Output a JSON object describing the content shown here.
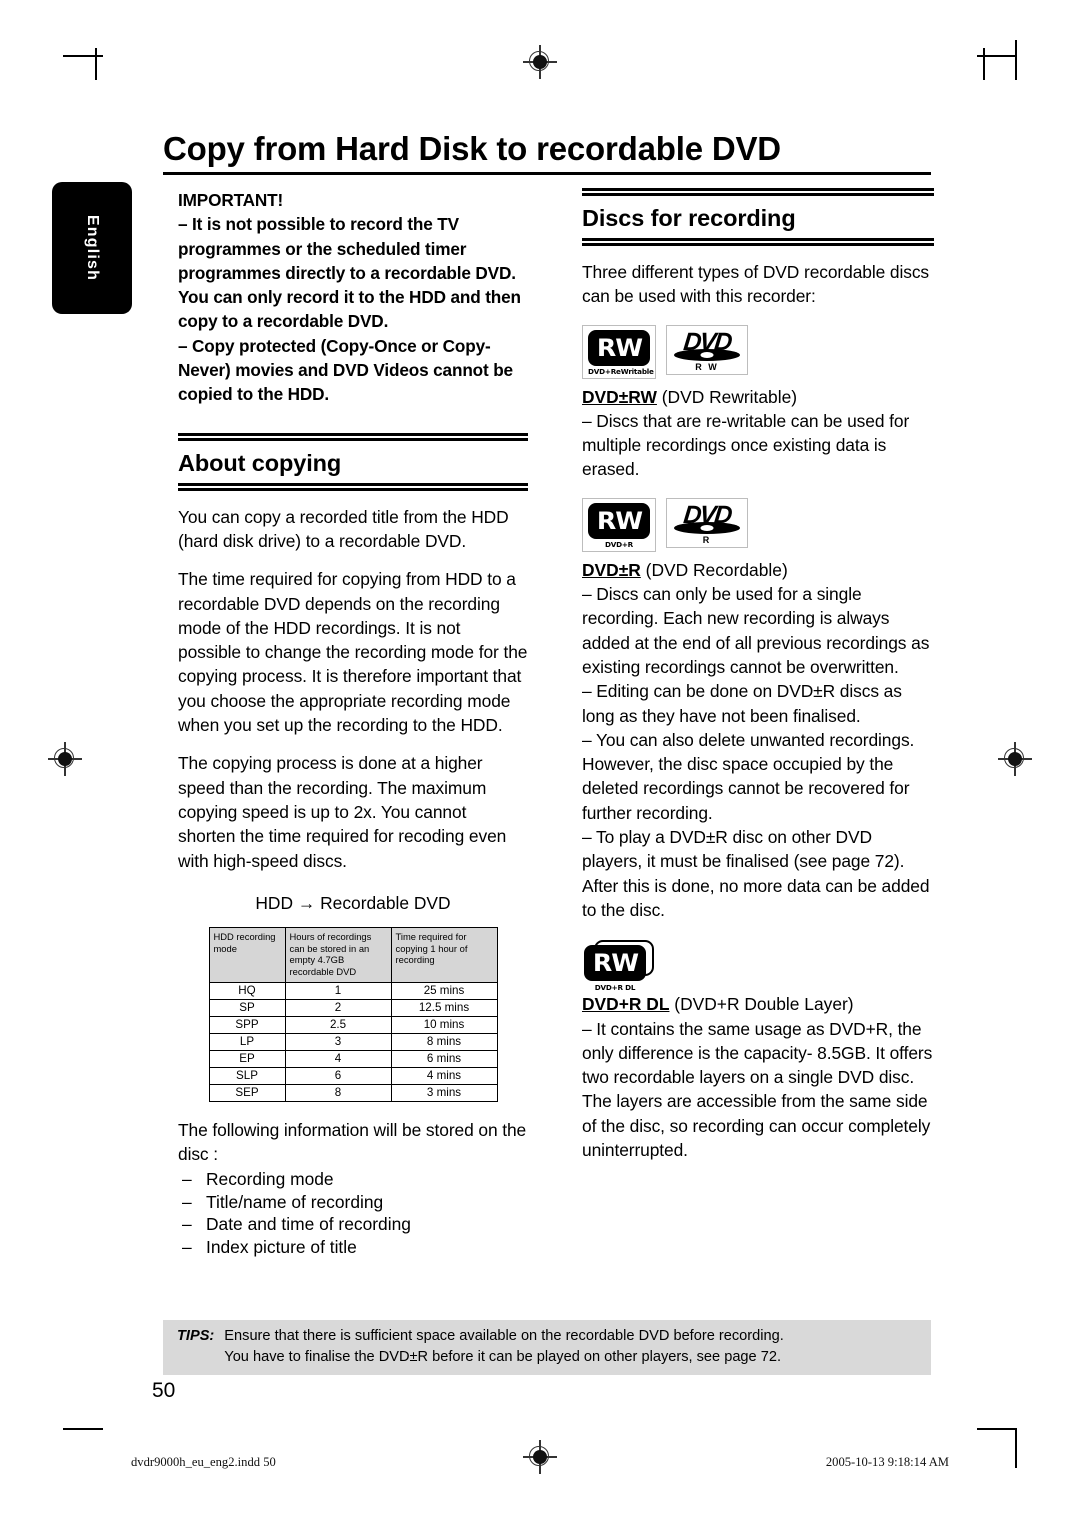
{
  "page": {
    "title": "Copy from Hard Disk to recordable DVD",
    "language_tab": "English",
    "page_number": "50"
  },
  "left_column": {
    "important": {
      "heading": "IMPORTANT!",
      "paragraphs": [
        "– It is not possible to record the TV programmes or the scheduled timer programmes directly to a recordable DVD.  You can only record it to the HDD and then copy to a recordable DVD.",
        "– Copy protected (Copy-Once or Copy-Never) movies and DVD Videos cannot be copied to the HDD."
      ]
    },
    "about_copying": {
      "heading": "About copying",
      "paragraphs": [
        "You can copy a recorded title from the HDD (hard disk drive) to a recordable DVD.",
        "The time required for copying from HDD to a recordable DVD depends on the recording mode of the HDD recordings. It is not possible to change the recording mode for the copying process. It is therefore important that you choose the appropriate recording mode when you set up the recording to the HDD.",
        "The copying process is done at a higher speed than the recording. The maximum copying speed is up to 2x.  You cannot shorten the time required for recoding even with high-speed discs."
      ],
      "flow_caption": "HDD → Recordable DVD"
    },
    "table": {
      "headers": [
        "HDD recording mode",
        "Hours of recordings can be stored in an empty 4.7GB recordable DVD",
        "Time required for copying 1 hour of recording"
      ],
      "rows": [
        [
          "HQ",
          "1",
          "25 mins"
        ],
        [
          "SP",
          "2",
          "12.5 mins"
        ],
        [
          "SPP",
          "2.5",
          "10 mins"
        ],
        [
          "LP",
          "3",
          "8 mins"
        ],
        [
          "EP",
          "4",
          "6 mins"
        ],
        [
          "SLP",
          "6",
          "4 mins"
        ],
        [
          "SEP",
          "8",
          "3 mins"
        ]
      ]
    },
    "stored_info": {
      "intro": "The following information will be stored on the disc :",
      "items": [
        "Recording mode",
        "Title/name of recording",
        "Date and time of recording",
        "Index picture of title"
      ],
      "dash": "–"
    }
  },
  "right_column": {
    "discs_for_recording": {
      "heading": "Discs for recording",
      "intro": "Three different types of DVD recordable discs can be used with this recorder:"
    },
    "dvd_rw": {
      "logo_rw_glyph": "RW",
      "logo_rw_caption": "DVD+ReWritable",
      "logo_dvd_word": "DVD",
      "logo_dvd_sub": "R W",
      "title_bold": "DVD±RW",
      "title_rest": " (DVD Rewritable)",
      "body": "– Discs that are re-writable can be used for multiple recordings once existing data is erased."
    },
    "dvd_r": {
      "logo_rw_glyph": "RW",
      "logo_rw_caption": "DVD+R",
      "logo_dvd_word": "DVD",
      "logo_dvd_sub": "R",
      "title_bold": "DVD±R",
      "title_rest": " (DVD Recordable)",
      "body": [
        "– Discs can only be used for a single recording. Each new recording is always added at the end of all previous recordings as existing recordings cannot be overwritten.",
        "– Editing can be done on DVD±R discs as long as they have not been finalised.",
        "– You can also delete unwanted recordings. However, the disc space occupied by the deleted recordings cannot be recovered for further recording.",
        "– To play a DVD±R disc on other DVD players, it must be finalised (see page 72). After this is done, no more data can be added to the disc."
      ]
    },
    "dvd_r_dl": {
      "logo_rw_glyph": "RW",
      "logo_rw_caption": "DVD+R DL",
      "title_bold": "DVD+R DL",
      "title_rest": " (DVD+R Double Layer)",
      "body": "– It contains the same usage as DVD+R, the only difference is the capacity- 8.5GB. It offers two recordable layers on a single DVD disc.  The layers are accessible from the same side of the disc, so recording can occur completely uninterrupted."
    }
  },
  "tips": {
    "label": "TIPS:",
    "lines": [
      "Ensure that there is sufficient space available on the recordable DVD before recording.",
      "You have to finalise the DVD±R before it can be played on other players, see page 72."
    ]
  },
  "footer": {
    "file": "dvdr9000h_eu_eng2.indd   50",
    "timestamp": "2005-10-13   9:18:14 AM"
  },
  "colors": {
    "tips_background": "#d9d9d9",
    "table_header_background": "#d6d6d6",
    "tab_background": "#000000"
  }
}
